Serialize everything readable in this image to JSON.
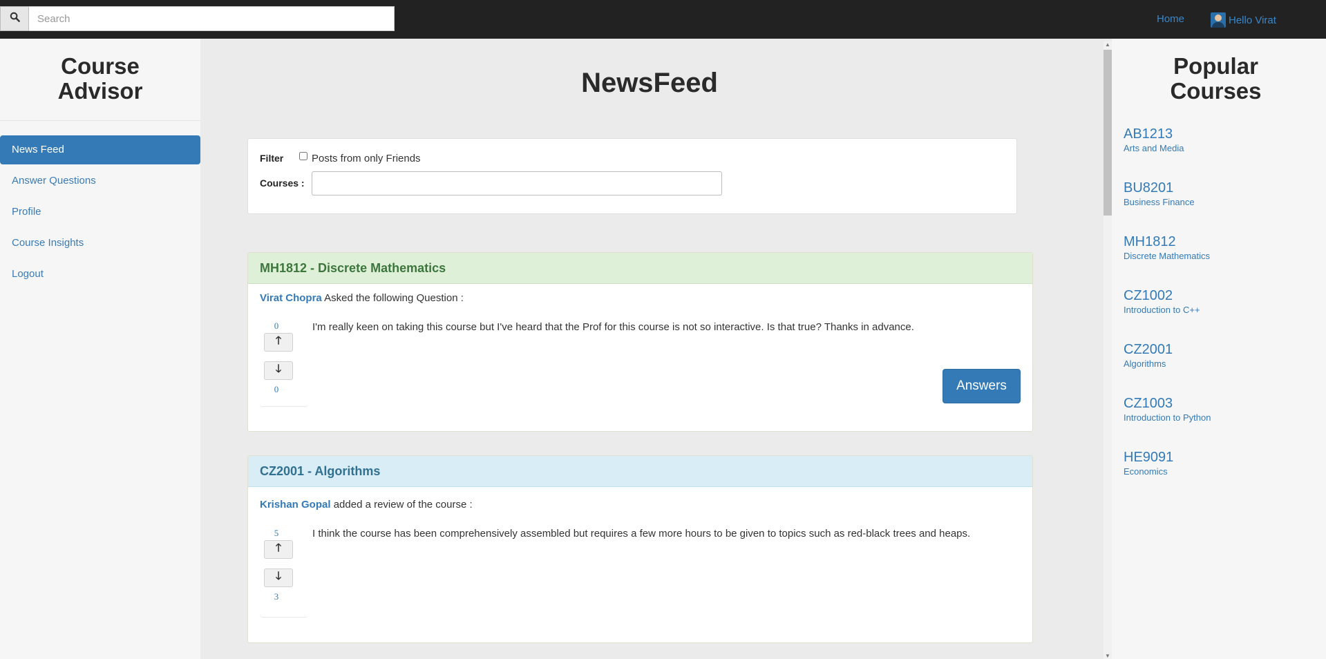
{
  "topbar": {
    "search_placeholder": "Search",
    "home_label": "Home",
    "user_label": "Hello Virat"
  },
  "sidebar": {
    "brand": "Course Advisor",
    "items": [
      {
        "label": "News Feed",
        "active": true
      },
      {
        "label": "Answer Questions",
        "active": false
      },
      {
        "label": "Profile",
        "active": false
      },
      {
        "label": "Course Insights",
        "active": false
      },
      {
        "label": "Logout",
        "active": false
      }
    ]
  },
  "main": {
    "title": "NewsFeed",
    "filter": {
      "label": "Filter",
      "checkbox_label": "Posts from only Friends",
      "checkbox_checked": false,
      "courses_label": "Courses :",
      "courses_value": ""
    },
    "posts": [
      {
        "header": "MH1812 - Discrete Mathematics",
        "header_color": "#dff0d8",
        "author": "Virat Chopra",
        "action": "Asked the following Question :",
        "text": "I'm really keen on taking this course but I've heard that the Prof for this course is not so interactive. Is that true? Thanks in advance.",
        "upvotes": "0",
        "downvotes": "0",
        "button_label": "Answers"
      },
      {
        "header": "CZ2001 - Algorithms",
        "header_color": "#d9edf7",
        "author": "Krishan Gopal",
        "action": "added a review of the course :",
        "text": "I think the course has been comprehensively assembled but requires a few more hours to be given to topics such as red-black trees and heaps.",
        "upvotes": "5",
        "downvotes": "3"
      }
    ]
  },
  "popular": {
    "title": "Popular Courses",
    "courses": [
      {
        "code": "AB1213",
        "name": "Arts and Media"
      },
      {
        "code": "BU8201",
        "name": "Business Finance"
      },
      {
        "code": "MH1812",
        "name": "Discrete Mathematics"
      },
      {
        "code": "CZ1002",
        "name": "Introduction to C++"
      },
      {
        "code": "CZ2001",
        "name": "Algorithms"
      },
      {
        "code": "CZ1003",
        "name": "Introduction to Python"
      },
      {
        "code": "HE9091",
        "name": "Economics"
      }
    ]
  },
  "colors": {
    "accent": "#337ab7",
    "topbar": "#222222"
  }
}
